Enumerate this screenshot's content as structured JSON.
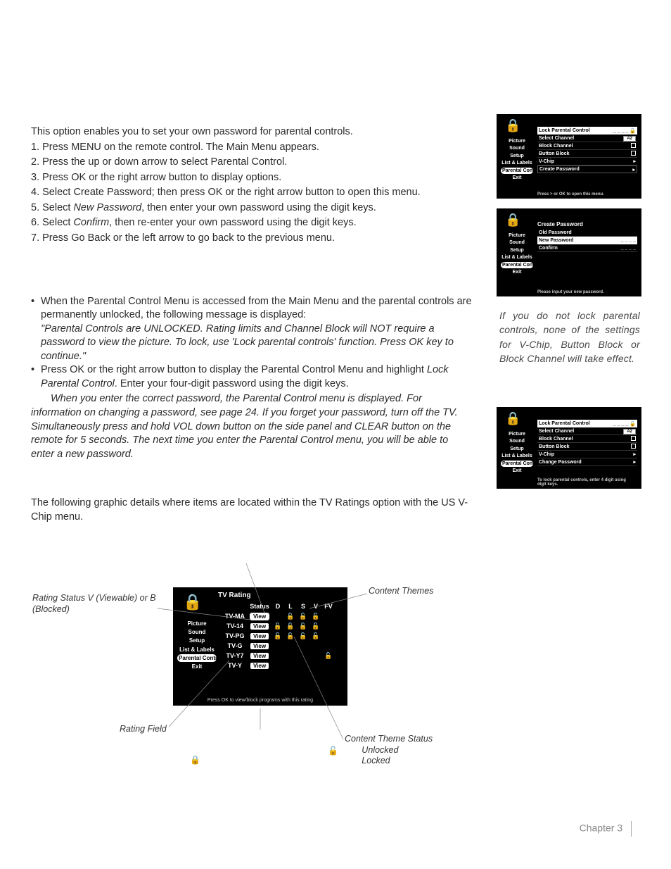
{
  "intro": "This option enables you to set your own password for parental controls.",
  "steps": [
    "1. Press MENU on the remote control. The Main Menu appears.",
    "2. Press the up or down arrow to select Parental Control.",
    "3. Press OK or the right arrow button to display options.",
    "4. Select Create Password; then press OK or the right arrow button to open this menu."
  ],
  "step5_a": "5. Select ",
  "step5_i": "New Password",
  "step5_b": ", then enter your own password using the digit keys.",
  "step6_a": "6. Select ",
  "step6_i": "Confirm",
  "step6_b": ", then re-enter your own password using the digit keys.",
  "step7": "7. Press Go Back or the left arrow to go back to the previous menu.",
  "note1_a": "When the Parental Control Menu is accessed from the Main Menu and the parental controls are permanently unlocked, the following message is displayed:",
  "note1_q": "\"Parental Controls are UNLOCKED. Rating limits and Channel Block will NOT require a password to view the picture. To lock, use 'Lock parental controls' function. Press OK key to continue.\"",
  "note2_a": "Press OK or the right arrow button to display the Parental Control Menu and highlight ",
  "note2_i": "Lock Parental Control",
  "note2_b": ". Enter your four-digit password using the digit keys.",
  "note_para": "When you enter the correct password, the Parental Control menu is displayed. For information on changing a password, see page 24. If you forget your password, turn off the TV. Simultaneously press and hold VOL down button on the side panel and CLEAR button on the remote for 5 seconds. The next time you enter the Parental Control menu, you will be able to enter a new password.",
  "us_intro": "The following graphic details where items are located within the TV Ratings option with the US V-Chip menu.",
  "side_note": "If you do not lock parental controls, none of the settings for V-Chip, Button Block or Block Channel will take effect.",
  "mini_sidebar": [
    "Picture",
    "Sound",
    "Setup",
    "List & Labels",
    "Parental Control",
    "Exit"
  ],
  "mini1": {
    "rows": [
      {
        "l": "Lock Parental Control",
        "r": "_ _ _ _",
        "hl": true,
        "lock": true
      },
      {
        "l": "Select Channel",
        "r": "A2",
        "pill": true
      },
      {
        "l": "Block Channel",
        "r": "box"
      },
      {
        "l": "Button Block",
        "r": "box"
      },
      {
        "l": "V-Chip",
        "r": "tri"
      },
      {
        "l": "Create Password",
        "r": "tri",
        "boxrow": true
      }
    ],
    "foot": "Press > or OK to open this menu."
  },
  "mini2": {
    "title": "Create Password",
    "rows": [
      {
        "l": "Old Password",
        "r": ""
      },
      {
        "l": "New Password",
        "r": "_ _ _ _",
        "hl": true
      },
      {
        "l": "Confirm",
        "r": "_ _ _ _"
      }
    ],
    "foot": "Please input your new password."
  },
  "mini3": {
    "rows": [
      {
        "l": "Lock Parental Control",
        "r": "_ _ _ _",
        "hl": true,
        "lock": true
      },
      {
        "l": "Select Channel",
        "r": "A2",
        "pill": true
      },
      {
        "l": "Block Channel",
        "r": "box"
      },
      {
        "l": "Button Block",
        "r": "box"
      },
      {
        "l": "V-Chip",
        "r": "tri"
      },
      {
        "l": "Change Password",
        "r": "tri"
      }
    ],
    "foot": "To lock parental controls, enter 4 digit using digit keys."
  },
  "tvbox": {
    "title": "TV Rating",
    "headers": [
      "",
      "Status",
      "D",
      "L",
      "S",
      "V",
      "FV"
    ],
    "rows": [
      {
        "l": "TV-MA",
        "st": "View",
        "c": [
          "",
          "u",
          "u",
          "u",
          ""
        ],
        "sel": true
      },
      {
        "l": "TV-14",
        "st": "View",
        "c": [
          "u",
          "u",
          "u",
          "u",
          ""
        ]
      },
      {
        "l": "TV-PG",
        "st": "View",
        "c": [
          "u",
          "u",
          "u",
          "u",
          ""
        ]
      },
      {
        "l": "TV-G",
        "st": "View",
        "c": [
          "",
          "",
          "",
          "",
          ""
        ]
      },
      {
        "l": "TV-Y7",
        "st": "View",
        "c": [
          "",
          "",
          "",
          "",
          "u"
        ]
      },
      {
        "l": "TV-Y",
        "st": "View",
        "c": [
          "",
          "",
          "",
          "",
          ""
        ]
      }
    ],
    "foot": "Press OK  to view/block programs with this rating"
  },
  "glabels": {
    "rating": "Rating Status V (Viewable) or B (Blocked)",
    "content": "Content Themes",
    "field": "Rating Field",
    "themestatus": "Content Theme Status\n       Unlocked\n       Locked"
  },
  "footer_chapter": "Chapter 3"
}
